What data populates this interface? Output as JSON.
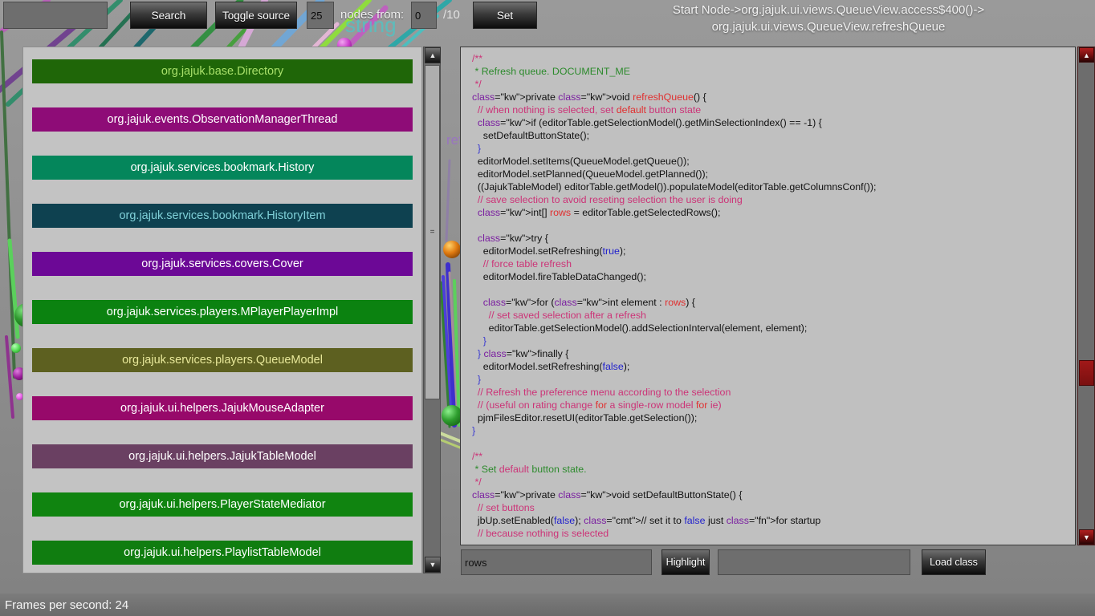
{
  "toolbar": {
    "search_value": "",
    "search_placeholder": "",
    "search_label": "Search",
    "toggle_source_label": "Toggle source",
    "node_count_value": "25",
    "nodes_from_label": "nodes from:",
    "start_index_value": "0",
    "total_pages_label": "/10",
    "set_label": "Set"
  },
  "path": {
    "line1": "Start Node->org.jajuk.ui.views.QueueView.access$400()->",
    "line2": "org.jajuk.ui.views.QueueView.refreshQueue"
  },
  "class_list": {
    "items": [
      {
        "label": "org.jajuk.base.Directory",
        "bg": "#1f6608",
        "fg": "#a8e06a"
      },
      {
        "label": "org.jajuk.events.ObservationManagerThread",
        "bg": "#8e0c77",
        "fg": "#ffffff"
      },
      {
        "label": "org.jajuk.services.bookmark.History",
        "bg": "#04865b",
        "fg": "#ffffff"
      },
      {
        "label": "org.jajuk.services.bookmark.HistoryItem",
        "bg": "#0e4150",
        "fg": "#7fd0d8"
      },
      {
        "label": "org.jajuk.services.covers.Cover",
        "bg": "#6c0896",
        "fg": "#ffffff"
      },
      {
        "label": "org.jajuk.services.players.MPlayerPlayerImpl",
        "bg": "#0b8210",
        "fg": "#ffffff"
      },
      {
        "label": "org.jajuk.services.players.QueueModel",
        "bg": "#5d6020",
        "fg": "#e8e89a"
      },
      {
        "label": "org.jajuk.ui.helpers.JajukMouseAdapter",
        "bg": "#97096a",
        "fg": "#ffffff"
      },
      {
        "label": "org.jajuk.ui.helpers.JajukTableModel",
        "bg": "#6a4062",
        "fg": "#ffffff"
      },
      {
        "label": "org.jajuk.ui.helpers.PlayerStateMediator",
        "bg": "#108410",
        "fg": "#ffffff"
      },
      {
        "label": "org.jajuk.ui.helpers.PlaylistTableModel",
        "bg": "#107d10",
        "fg": "#ffffff"
      }
    ]
  },
  "source_code": {
    "title": "org.jajuk.ui.views.QueueView.refreshQueue",
    "text": "/**\n * Refresh queue. DOCUMENT_ME\n */\nprivate void refreshQueue() {\n  // when nothing is selected, set default button state\n  if (editorTable.getSelectionModel().getMinSelectionIndex() == -1) {\n    setDefaultButtonState();\n  }\n  editorModel.setItems(QueueModel.getQueue());\n  editorModel.setPlanned(QueueModel.getPlanned());\n  ((JajukTableModel) editorTable.getModel()).populateModel(editorTable.getColumnsConf());\n  // save selection to avoid reseting selection the user is doing\n  int[] rows = editorTable.getSelectedRows();\n\n  try {\n    editorModel.setRefreshing(true);\n    // force table refresh\n    editorModel.fireTableDataChanged();\n\n    for (int element : rows) {\n      // set saved selection after a refresh\n      editorTable.getSelectionModel().addSelectionInterval(element, element);\n    }\n  } finally {\n    editorModel.setRefreshing(false);\n  }\n  // Refresh the preference menu according to the selection\n  // (useful on rating change for a single-row model for ie)\n  pjmFilesEditor.resetUI(editorTable.getSelection());\n}\n\n/**\n * Set default button state.\n */\nprivate void setDefaultButtonState() {\n  // set buttons\n  jbUp.setEnabled(false); // set it to false just for startup\n  // because nothing is selected"
  },
  "bottom_bar": {
    "highlight_value": "rows",
    "highlight_label": "Highlight",
    "class_name_value": "",
    "load_class_label": "Load class"
  },
  "status_bar": {
    "fps_text": "Frames per second: 24"
  },
  "scrollbars": {
    "up_arrow_glyph": "▲",
    "down_arrow_glyph": "▼",
    "thumb_grip_glyph": "="
  },
  "colors": {
    "panel_bg": "#c3c3c3",
    "code_bg": "#c0c0c0",
    "window_bg": "#8a8a8a",
    "code_scrollbar_accent": "#a01818"
  }
}
